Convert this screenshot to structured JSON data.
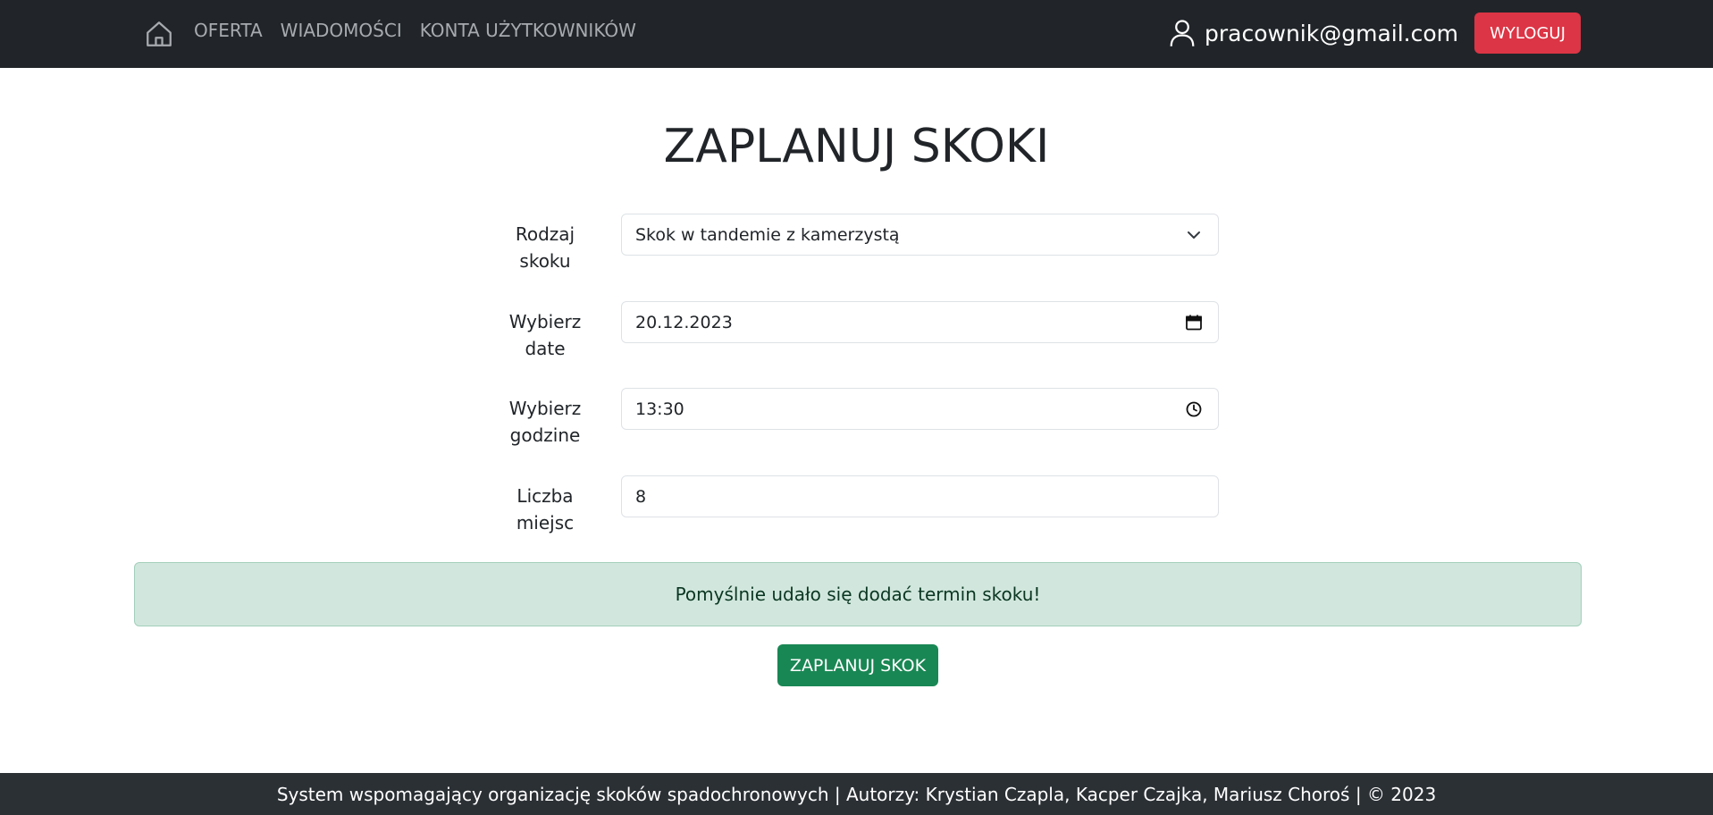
{
  "nav": {
    "links": [
      {
        "label": "OFERTA"
      },
      {
        "label": "WIADOMOŚCI"
      },
      {
        "label": "KONTA UŻYTKOWNIKÓW"
      }
    ],
    "user_email": "pracownik@gmail.com",
    "logout_label": "WYLOGUJ"
  },
  "page": {
    "title": "ZAPLANUJ SKOKI"
  },
  "form": {
    "jump_type": {
      "label_line1": "Rodzaj",
      "label_line2": "skoku",
      "value": "Skok w tandemie z kamerzystą"
    },
    "date": {
      "label_line1": "Wybierz",
      "label_line2": "date",
      "value": "20.12.2023"
    },
    "time": {
      "label_line1": "Wybierz",
      "label_line2": "godzine",
      "value": "13:30"
    },
    "seats": {
      "label_line1": "Liczba",
      "label_line2": "miejsc",
      "value": "8"
    },
    "submit_label": "ZAPLANUJ SKOK"
  },
  "alert": {
    "message": "Pomyślnie udało się dodać termin skoku!"
  },
  "footer": {
    "text": "System wspomagający organizację skoków spadochronowych | Autorzy: Krystian Czapla, Kacper Czajka, Mariusz Choroś | © 2023"
  },
  "colors": {
    "navbar_bg": "#212529",
    "danger": "#dc3545",
    "success": "#198754",
    "alert_success_bg": "#d1e7dd",
    "footer_bg": "#2b3035"
  },
  "icons": {
    "home": "home-icon",
    "user": "user-icon",
    "dropdown": "chevron-down-icon",
    "calendar": "calendar-icon",
    "clock": "clock-icon"
  }
}
